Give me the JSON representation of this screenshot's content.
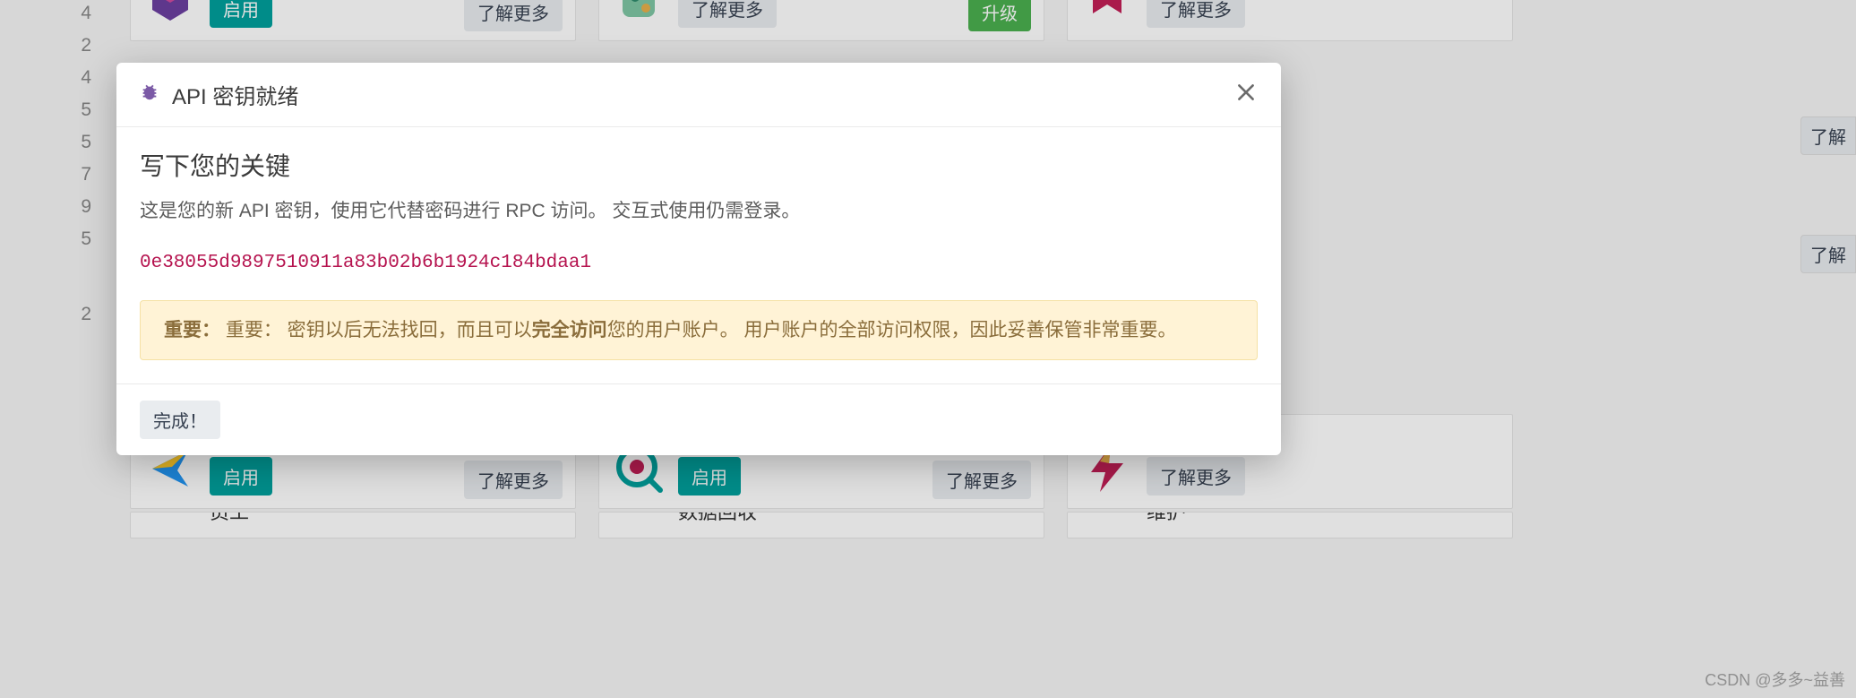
{
  "line_numbers": [
    "4",
    "2",
    "4",
    "5",
    "5",
    "7",
    "9",
    "5",
    "2"
  ],
  "buttons": {
    "activate": "启用",
    "learn_more": "了解更多",
    "upgrade": "升级",
    "done": "完成！",
    "side_learn": "了解"
  },
  "modules": {
    "hr_holidays": "hr_holidays",
    "hr_recruitment": "hr_recruitment",
    "industry_fsm": "industry_fsm",
    "staff": "员工",
    "data_recycle": "数据回收",
    "maintenance": "维护"
  },
  "modal": {
    "title": "API 密钥就绪",
    "heading": "写下您的关键",
    "description": "这是您的新 API 密钥，使用它代替密码进行 RPC 访问。 交互式使用仍需登录。",
    "api_key": "0e38055d9897510911a83b02b6b1924c184bdaa1",
    "alert_label": "重要：",
    "alert_prefix": "重要： 密钥以后无法找回，而且可以",
    "alert_bold": "完全访问",
    "alert_suffix": "您的用户账户。 用户账户的全部访问权限，因此妥善保管非常重要。"
  },
  "watermark": "CSDN @多多~益善"
}
